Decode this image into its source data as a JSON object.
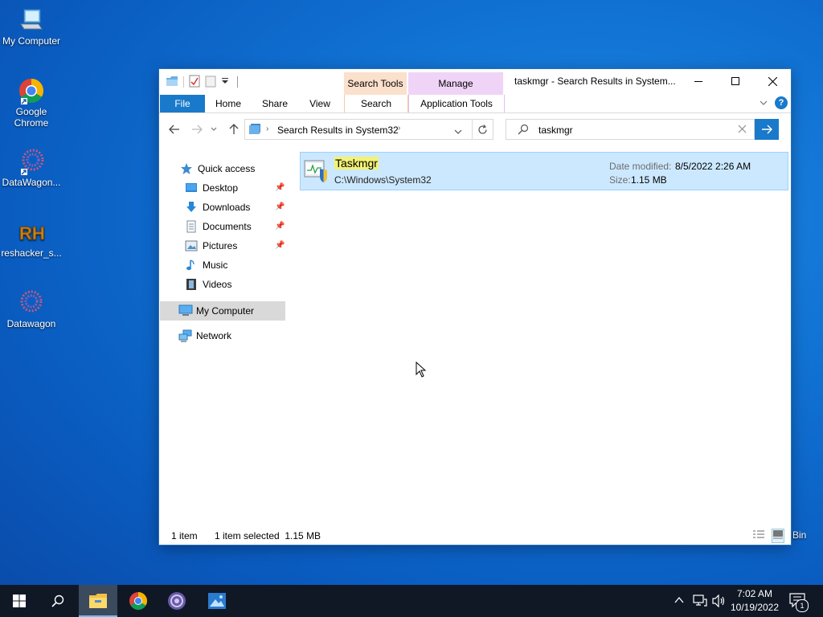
{
  "desktop": {
    "icons": [
      {
        "label": "My Computer"
      },
      {
        "label": "Google\nChrome"
      },
      {
        "label": "DataWagon..."
      },
      {
        "label": "reshacker_s..."
      },
      {
        "label": "Datawagon"
      }
    ],
    "recycle_label": "Bin"
  },
  "window": {
    "title": "taskmgr - Search Results in System...",
    "context_tabs": {
      "search_tools": "Search Tools",
      "manage": "Manage"
    },
    "ribbon_tabs": {
      "file": "File",
      "home": "Home",
      "share": "Share",
      "view": "View",
      "search": "Search",
      "application_tools": "Application Tools"
    },
    "address": {
      "path": "Search Results in System32"
    },
    "search": {
      "value": "taskmgr"
    },
    "nav": {
      "quick_access": "Quick access",
      "desktop": "Desktop",
      "downloads": "Downloads",
      "documents": "Documents",
      "pictures": "Pictures",
      "music": "Music",
      "videos": "Videos",
      "my_computer": "My Computer",
      "network": "Network"
    },
    "result": {
      "name": "Taskmgr",
      "path": "C:\\Windows\\System32",
      "date_label": "Date modified:",
      "date_value": "8/5/2022 2:26 AM",
      "size_label": "Size:",
      "size_value": "1.15 MB"
    },
    "status": {
      "count": "1 item",
      "selected": "1 item selected  1.15 MB"
    }
  },
  "taskbar": {
    "time": "7:02 AM",
    "date": "10/19/2022",
    "notification_count": "1"
  },
  "colors": {
    "accent": "#1979ca",
    "search_tools_tab": "#fbe0cc",
    "manage_tab": "#f0d4f7",
    "selection": "#cce8ff",
    "taskbar": "#101826"
  }
}
